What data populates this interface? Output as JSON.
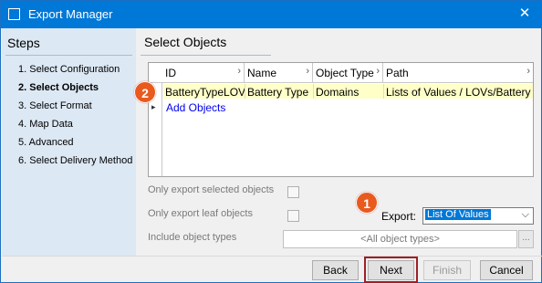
{
  "window": {
    "title": "Export Manager"
  },
  "sidebar": {
    "title": "Steps",
    "steps": [
      {
        "label": "1. Select Configuration",
        "active": false
      },
      {
        "label": "2. Select Objects",
        "active": true
      },
      {
        "label": "3. Select Format",
        "active": false
      },
      {
        "label": "4. Map Data",
        "active": false
      },
      {
        "label": "5. Advanced",
        "active": false
      },
      {
        "label": "6. Select Delivery Method",
        "active": false
      }
    ]
  },
  "main": {
    "title": "Select Objects",
    "grid": {
      "columns": [
        "ID",
        "Name",
        "Object Type",
        "Path"
      ],
      "rows": [
        [
          "BatteryTypeLOV",
          "Battery Type",
          "Domains",
          "Lists of Values / LOVs/Battery ..."
        ]
      ],
      "add_label": "Add Objects"
    },
    "options": {
      "only_selected_label": "Only export selected objects",
      "only_leaf_label": "Only export leaf objects",
      "include_types_label": "Include object types",
      "include_types_value": "<All object types>",
      "browse_label": "..."
    },
    "export": {
      "label": "Export:",
      "selected": "List Of Values"
    }
  },
  "callouts": {
    "one": "1",
    "two": "2"
  },
  "footer": {
    "back_label": "Back",
    "next_label": "Next",
    "finish_label": "Finish",
    "cancel_label": "Cancel"
  },
  "colors": {
    "titlebar": "#0078d7",
    "sidebar": "#dce8f4",
    "selected_row": "#ffffc8",
    "callout": "#e85a1e",
    "next_highlight": "#9e1f26"
  }
}
